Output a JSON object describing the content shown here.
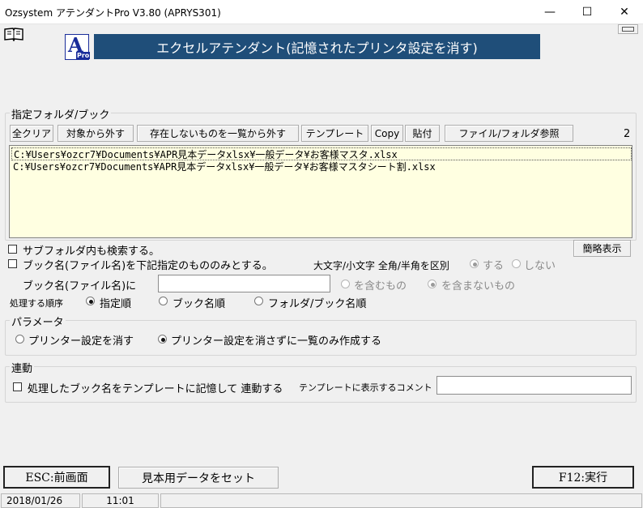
{
  "window": {
    "title": "Ozsystem アテンダントPro V3.80 (APRYS301)",
    "min_label": "—",
    "max_label": "☐",
    "close_label": "✕"
  },
  "header": {
    "logo_letter": "A",
    "logo_sub": "Pro",
    "banner": "エクセルアテンダント(記憶されたプリンタ設定を消す)"
  },
  "folder_group": {
    "legend": "指定フォルダ/ブック",
    "buttons": [
      "全クリア",
      "対象から外す",
      "存在しないものを一覧から外す",
      "テンプレート",
      "Copy",
      "貼付",
      "ファイル/フォルダ参照"
    ],
    "count": "2",
    "files": [
      "C:¥Users¥ozcr7¥Documents¥APR見本データxlsx¥一般データ¥お客様マスタ.xlsx",
      "C:¥Users¥ozcr7¥Documents¥APR見本データxlsx¥一般データ¥お客様マスタシート割.xlsx"
    ]
  },
  "options": {
    "subfolder_label": "サブフォルダ内も検索する。",
    "brief_button": "簡略表示",
    "bookname_only_label": "ブック名(ファイル名)を下記指定のもののみとする。",
    "case_label": "大文字/小文字 全角/半角を区別",
    "case_yes": "する",
    "case_no": "しない",
    "bookname_field_label": "ブック名(ファイル名)に",
    "bookname_value": "",
    "contains": "を含むもの",
    "not_contains": "を含まないもの",
    "order_label": "処理する順序",
    "order_specified": "指定順",
    "order_book": "ブック名順",
    "order_folder": "フォルダ/ブック名順"
  },
  "params": {
    "legend": "パラメータ",
    "opt_delete": "プリンター設定を消す",
    "opt_list_only": "プリンター設定を消さずに一覧のみ作成する"
  },
  "link": {
    "legend": "連動",
    "remember_label": "処理したブック名をテンプレートに記憶して 連動する",
    "comment_label": "テンプレートに表示するコメント",
    "comment_value": ""
  },
  "footer": {
    "esc_button": "ESC:前画面",
    "sample_button": "見本用データをセット",
    "f12_button": "F12:実行",
    "date": "2018/01/26",
    "time": "11:01"
  },
  "colors": {
    "banner_bg": "#1f4e79",
    "banner_text": "#ffffff",
    "logo_blue": "#1a2d9a",
    "list_bg": "#ffffe1"
  }
}
